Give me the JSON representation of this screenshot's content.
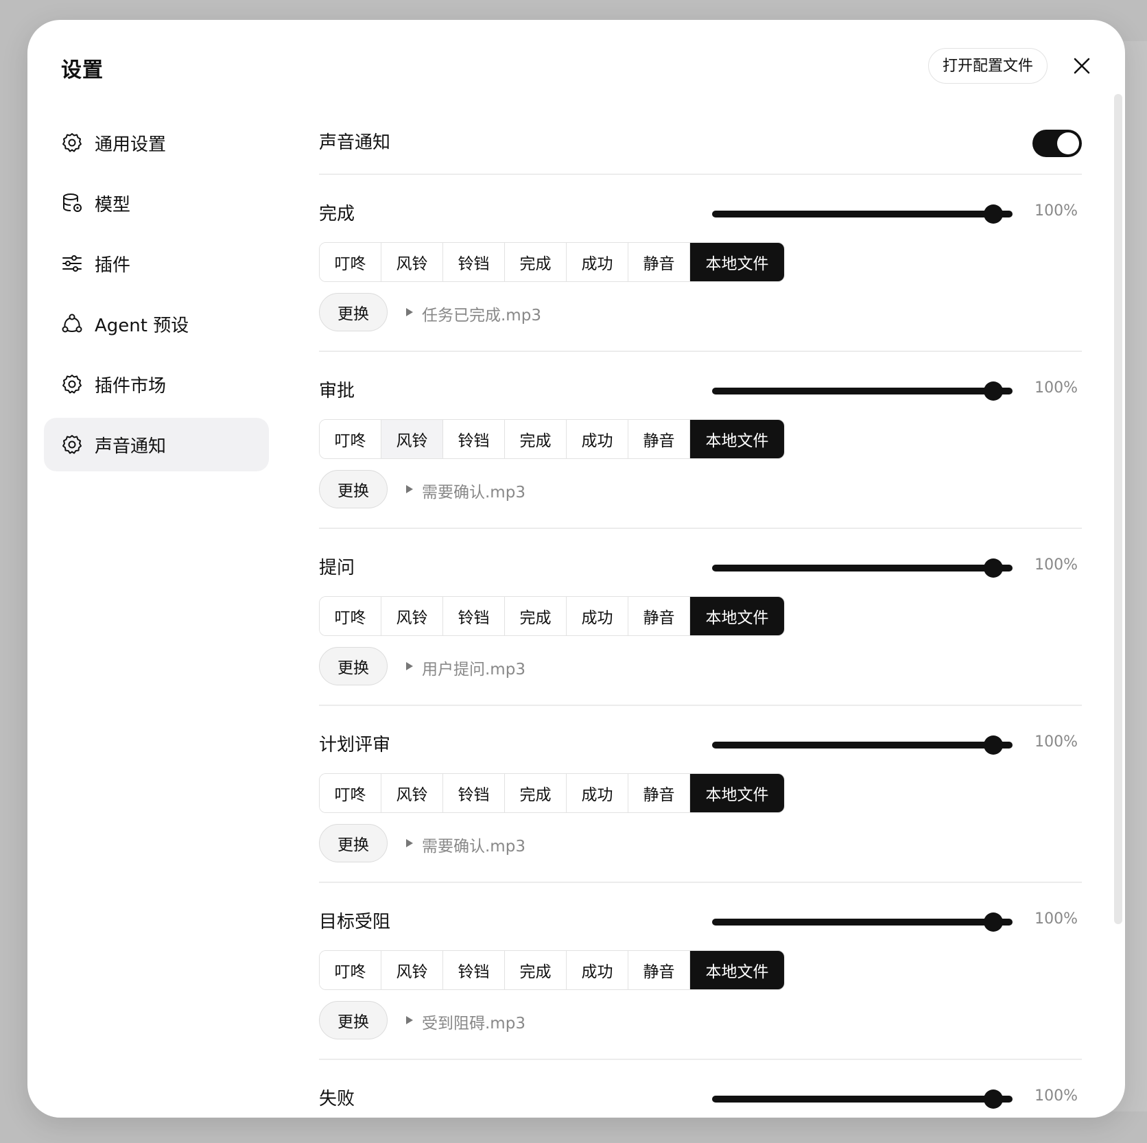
{
  "modal": {
    "title": "设置",
    "open_config_label": "打开配置文件"
  },
  "sidebar": {
    "items": [
      {
        "label": "通用设置",
        "icon": "gear-icon"
      },
      {
        "label": "模型",
        "icon": "database-gear-icon"
      },
      {
        "label": "插件",
        "icon": "sliders-icon"
      },
      {
        "label": "Agent 预设",
        "icon": "agent-network-icon"
      },
      {
        "label": "插件市场",
        "icon": "gear-icon"
      },
      {
        "label": "声音通知",
        "icon": "gear-icon",
        "active": true
      }
    ]
  },
  "sound": {
    "master_label": "声音通知",
    "master_enabled": true,
    "options": [
      "叮咚",
      "风铃",
      "铃铛",
      "完成",
      "成功",
      "静音",
      "本地文件"
    ],
    "replace_label": "更换",
    "sections": [
      {
        "title": "完成",
        "volume": "100%",
        "volume_value": 100,
        "selected": "本地文件",
        "file": "任务已完成.mp3"
      },
      {
        "title": "审批",
        "volume": "100%",
        "volume_value": 100,
        "selected": "本地文件",
        "file": "需要确认.mp3"
      },
      {
        "title": "提问",
        "volume": "100%",
        "volume_value": 100,
        "selected": "本地文件",
        "file": "用户提问.mp3"
      },
      {
        "title": "计划评审",
        "volume": "100%",
        "volume_value": 100,
        "selected": "本地文件",
        "file": "需要确认.mp3"
      },
      {
        "title": "目标受阻",
        "volume": "100%",
        "volume_value": 100,
        "selected": "本地文件",
        "file": "受到阻碍.mp3"
      }
    ],
    "last_section": {
      "title": "失败",
      "volume": "100%",
      "volume_value": 100
    }
  },
  "colors": {
    "accent": "#111111",
    "active_bg": "#f1f1f3",
    "muted_text": "#888888"
  }
}
